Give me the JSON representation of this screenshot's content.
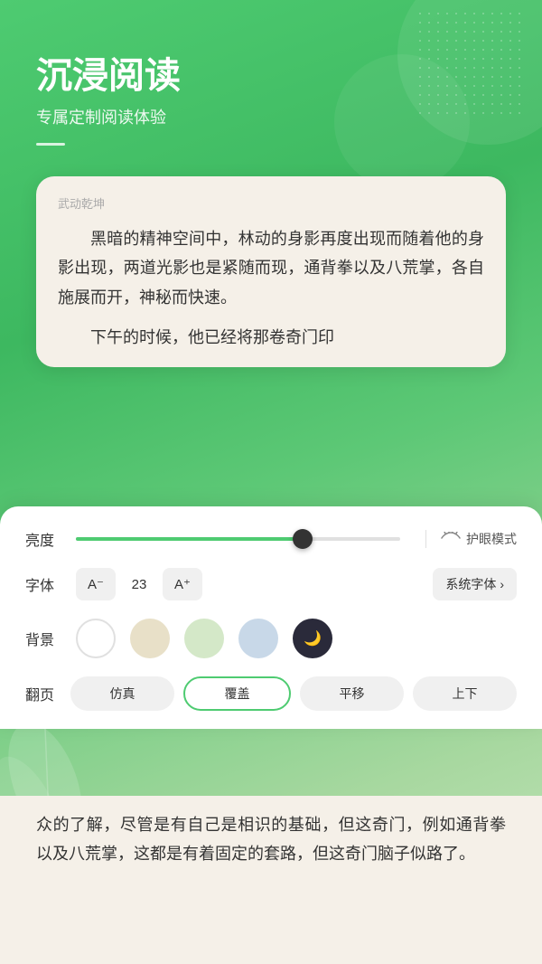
{
  "header": {
    "title": "沉浸阅读",
    "subtitle": "专属定制阅读体验"
  },
  "reader": {
    "book_title": "武动乾坤",
    "content_para1": "黑暗的精神空间中，林动的身影再度出现而随着他的身影出现，两道光影也是紧随而现，通背拳以及八荒掌，各自施展而开，神秘而快速。",
    "content_para2": "下午的时候，他已经将那卷奇门印"
  },
  "settings": {
    "brightness_label": "亮度",
    "eye_mode_label": "护眼模式",
    "font_label": "字体",
    "font_decrease_label": "A⁻",
    "font_size": "23",
    "font_increase_label": "A⁺",
    "font_type_label": "系统字体",
    "font_type_arrow": "›",
    "bg_label": "背景",
    "page_label": "翻页",
    "page_options": [
      "仿真",
      "覆盖",
      "平移",
      "上下"
    ],
    "active_page_option": "覆盖"
  },
  "bottom_content": {
    "text": "众的了解，尽管是有自己是相识的基础，但这奇门，例如通背拳以及八荒掌，这都是有着固定的套路，但这奇门脑子似路了。"
  },
  "colors": {
    "accent": "#4ecb71",
    "bg_gradient_start": "#4ecb71",
    "bg_gradient_end": "#c8e6c0"
  }
}
